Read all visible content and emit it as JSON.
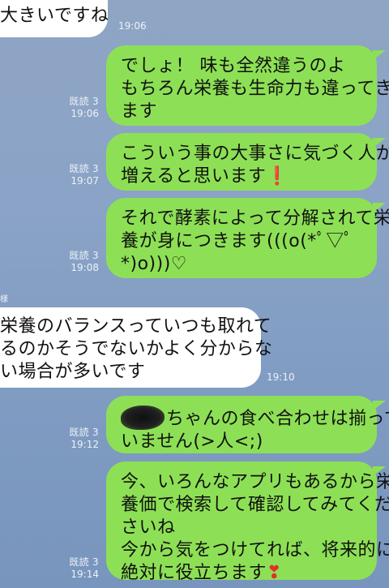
{
  "messages": [
    {
      "direction": "in",
      "lines": [
        "大きいですね"
      ],
      "time": "19:06"
    },
    {
      "direction": "out",
      "lines": [
        "でしょ！ 味も全然違うのよ",
        "もちろん栄養も生命力も違ってき",
        "ます"
      ],
      "read": "既読 3",
      "time": "19:06"
    },
    {
      "direction": "out",
      "lines": [
        "こういう事の大事さに気づく人が",
        "増えると思います"
      ],
      "emoji": "❗",
      "read": "既読 3",
      "time": "19:07"
    },
    {
      "direction": "out",
      "lines": [
        "それで酵素によって分解されて栄",
        "養が身につきます(((o(*ﾟ▽ﾟ",
        "*)o)))♡"
      ],
      "read": "既読 3",
      "time": "19:08"
    },
    {
      "direction": "in",
      "sender_mark": "様",
      "lines": [
        "栄養のバランスっていつも取れて",
        "るのかそうでないかよく分からな",
        "い場合が多いです"
      ],
      "time": "19:10"
    },
    {
      "direction": "out",
      "lines": [
        "ちゃんの食べ合わせは揃って",
        "いません(>人<;)"
      ],
      "read": "既読 3",
      "time": "19:12"
    },
    {
      "direction": "out",
      "lines": [
        "今、いろんなアプリもあるから栄",
        "養価で検索して確認してみてくだ",
        "さいね",
        "今から気をつけてれば、将来的に",
        "絶対に役立ちます"
      ],
      "emoji": "❣",
      "read": "既読 3",
      "time": "19:14"
    }
  ],
  "colors": {
    "outgoing_bubble": "#8de055",
    "incoming_bubble": "#ffffff",
    "background": "#8aa3c6",
    "meta_text": "#edf1f7"
  },
  "icons": {
    "redaction": "scribble-redaction"
  }
}
